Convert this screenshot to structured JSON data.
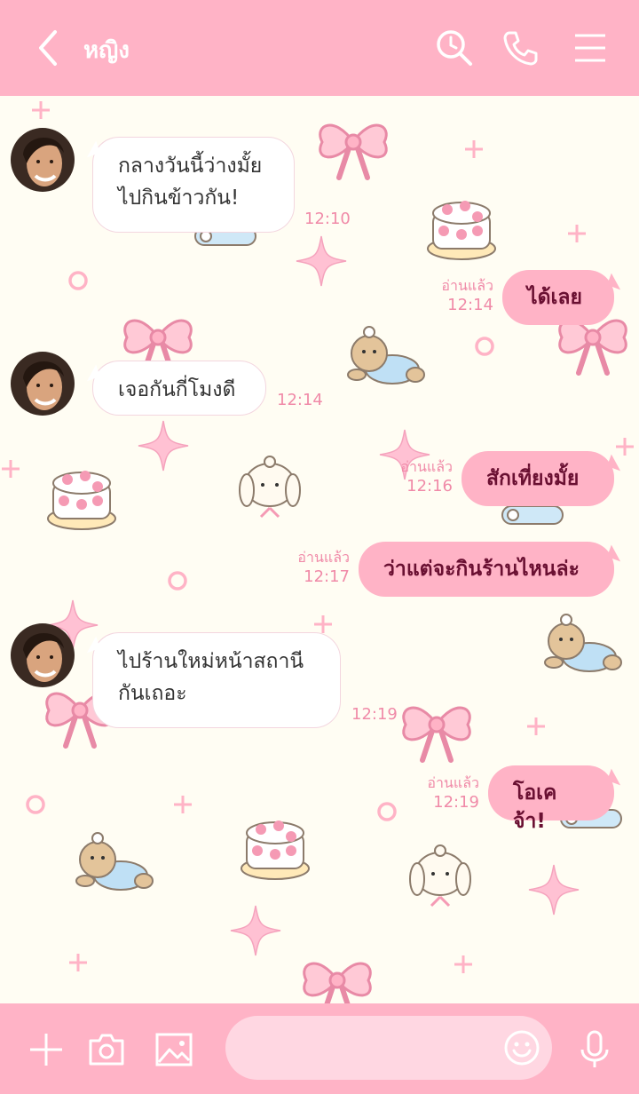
{
  "header": {
    "contact_name": "หญิง",
    "icons": [
      "chevron-left-icon",
      "search-clock-icon",
      "phone-icon",
      "menu-icon"
    ]
  },
  "colors": {
    "header_bg": "#ffb3c6",
    "chat_bg": "#fffdf3",
    "outgoing_bubble": "#ffb3c6",
    "incoming_bubble": "#ffffff",
    "outgoing_text": "#6a1032",
    "time_text": "#f08aa8"
  },
  "messages": [
    {
      "direction": "in",
      "lines": [
        "กลางวันนี้ว่างมั้ย",
        "ไปกินข้าวกัน!"
      ],
      "time": "12:10"
    },
    {
      "direction": "out",
      "text": "ได้เลย",
      "read": "อ่านแล้ว",
      "time": "12:14"
    },
    {
      "direction": "in",
      "lines": [
        "เจอกันกี่โมงดี"
      ],
      "time": "12:14"
    },
    {
      "direction": "out",
      "text": "สักเที่ยงมั้ย",
      "read": "อ่านแล้ว",
      "time": "12:16"
    },
    {
      "direction": "out",
      "text": "ว่าแต่จะกินร้านไหนล่ะ",
      "read": "อ่านแล้ว",
      "time": "12:17"
    },
    {
      "direction": "in",
      "lines": [
        "ไปร้านใหม่หน้าสถานี",
        "กันเถอะ"
      ],
      "time": "12:19"
    },
    {
      "direction": "out",
      "text": "โอเคจ้า!",
      "read": "อ่านแล้ว",
      "time": "12:19"
    }
  ],
  "footer": {
    "message_value": "",
    "icons": [
      "plus-icon",
      "camera-icon",
      "image-icon",
      "smiley-icon",
      "microphone-icon"
    ]
  }
}
